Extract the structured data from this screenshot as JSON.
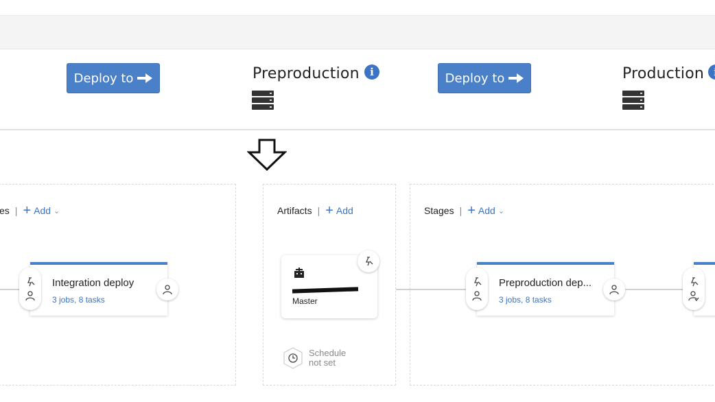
{
  "actions": {
    "deploy_left": "Deploy to",
    "deploy_right": "Deploy to"
  },
  "environments": {
    "preproduction": "Preproduction",
    "production": "Production"
  },
  "left_panel": {
    "header_partial": "es",
    "add_label": "Add",
    "stage_name": "Integration deploy",
    "stage_meta": "3 jobs, 8 tasks"
  },
  "artifacts_panel": {
    "header": "Artifacts",
    "add_label": "Add",
    "branch": "Master",
    "schedule_line1": "Schedule",
    "schedule_line2": "not set"
  },
  "stages_panel": {
    "header": "Stages",
    "add_label": "Add",
    "stage_name": "Preproduction dep...",
    "stage_meta": "3 jobs, 8 tasks"
  },
  "colors": {
    "accent": "#4a80c8",
    "stage_bar": "#4a7fcb",
    "link": "#3b74c4"
  },
  "icons": [
    "arrow-right-icon",
    "info-icon",
    "server-icon",
    "down-arrow-icon",
    "plus-icon",
    "chevron-down-icon",
    "trigger-icon",
    "person-icon",
    "build-icon",
    "clock-icon"
  ]
}
